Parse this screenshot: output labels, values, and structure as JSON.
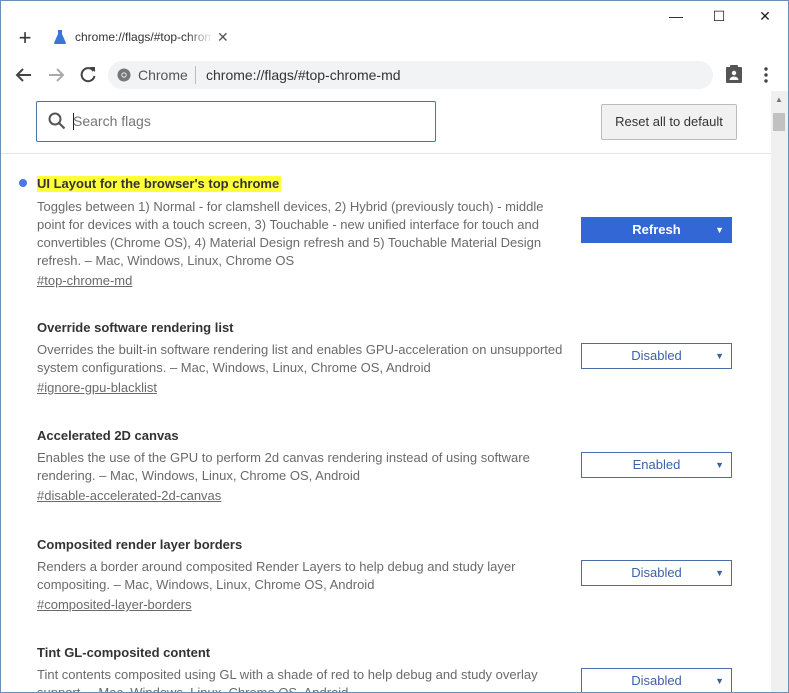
{
  "tab": {
    "title": "chrome://flags/#top-chrome-md",
    "close_glyph": "✕"
  },
  "window": {
    "minimize": "—",
    "maximize": "☐",
    "close": "✕"
  },
  "toolbar": {
    "chip_label": "Chrome",
    "url": "chrome://flags/#top-chrome-md"
  },
  "search": {
    "placeholder": "Search flags",
    "value": ""
  },
  "reset_label": "Reset all to default",
  "experiments": [
    {
      "name": "UI Layout for the browser's top chrome",
      "description": "Toggles between 1) Normal - for clamshell devices, 2) Hybrid (previously touch) - middle point for devices with a touch screen, 3) Touchable - new unified interface for touch and convertibles (Chrome OS), 4) Material Design refresh and 5) Touchable Material Design refresh. – Mac, Windows, Linux, Chrome OS",
      "link": "#top-chrome-md",
      "value": "Refresh"
    },
    {
      "name": "Override software rendering list",
      "description": "Overrides the built-in software rendering list and enables GPU-acceleration on unsupported system configurations. – Mac, Windows, Linux, Chrome OS, Android",
      "link": "#ignore-gpu-blacklist",
      "value": "Disabled"
    },
    {
      "name": "Accelerated 2D canvas",
      "description": "Enables the use of the GPU to perform 2d canvas rendering instead of using software rendering. – Mac, Windows, Linux, Chrome OS, Android",
      "link": "#disable-accelerated-2d-canvas",
      "value": "Enabled"
    },
    {
      "name": "Composited render layer borders",
      "description": "Renders a border around composited Render Layers to help debug and study layer compositing. – Mac, Windows, Linux, Chrome OS, Android",
      "link": "#composited-layer-borders",
      "value": "Disabled"
    },
    {
      "name": "Tint GL-composited content",
      "description": "Tint contents composited using GL with a shade of red to help debug and study overlay support. – Mac, Windows, Linux, Chrome OS, Android",
      "link": "",
      "value": "Disabled"
    }
  ],
  "dropdown_arrow": "▼",
  "colors": {
    "accent": "#3367d6",
    "highlight": "#ffff3a",
    "modified_dot": "#4a76e8"
  },
  "icons": [
    "new-tab-icon",
    "flask-icon",
    "back-icon",
    "forward-icon",
    "reload-icon",
    "globe-icon",
    "clipboard-icon",
    "kebab-menu-icon",
    "search-icon"
  ]
}
